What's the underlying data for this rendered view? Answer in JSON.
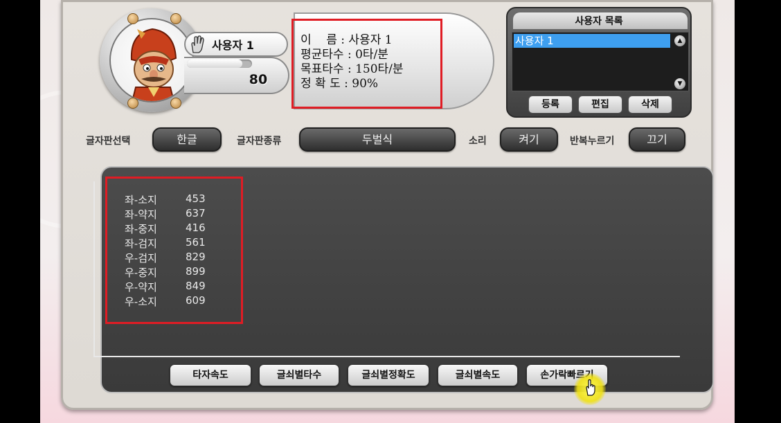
{
  "user": {
    "name": "사용자 1",
    "level": "80",
    "level_progress": 0.85
  },
  "info": {
    "name_line": "이    름 : 사용자 1",
    "avg_speed_line": "평균타수 : 0타/분",
    "target_speed_line": "목표타수 : 150타/분",
    "accuracy_line": "정 확 도 : 90%"
  },
  "user_list": {
    "title": "사용자 목록",
    "items": [
      "사용자 1"
    ],
    "buttons": {
      "register": "등록",
      "edit": "편집",
      "delete": "삭제"
    }
  },
  "options": {
    "keyboard_select_label": "글자판선택",
    "keyboard_select_value": "한글",
    "keyboard_type_label": "글자판종류",
    "keyboard_type_value": "두벌식",
    "sound_label": "소리",
    "sound_value": "켜기",
    "repeat_label": "반복누르기",
    "repeat_value": "끄기"
  },
  "finger_stats": [
    {
      "finger": "좌-소지",
      "value": "453"
    },
    {
      "finger": "좌-약지",
      "value": "637"
    },
    {
      "finger": "좌-중지",
      "value": "416"
    },
    {
      "finger": "좌-검지",
      "value": "561"
    },
    {
      "finger": "우-검지",
      "value": "829"
    },
    {
      "finger": "우-중지",
      "value": "899"
    },
    {
      "finger": "우-약지",
      "value": "849"
    },
    {
      "finger": "우-소지",
      "value": "609"
    }
  ],
  "tabs": {
    "typing_speed": "타자속도",
    "key_speed_count": "글쇠별타수",
    "key_accuracy": "글쇠별정확도",
    "key_speed": "글쇠별속도",
    "finger_speed": "손가락빠르기"
  },
  "colors": {
    "highlight_border": "#e01c24",
    "selected_row": "#3e9ff0",
    "cursor_halo": "#f0e514"
  }
}
